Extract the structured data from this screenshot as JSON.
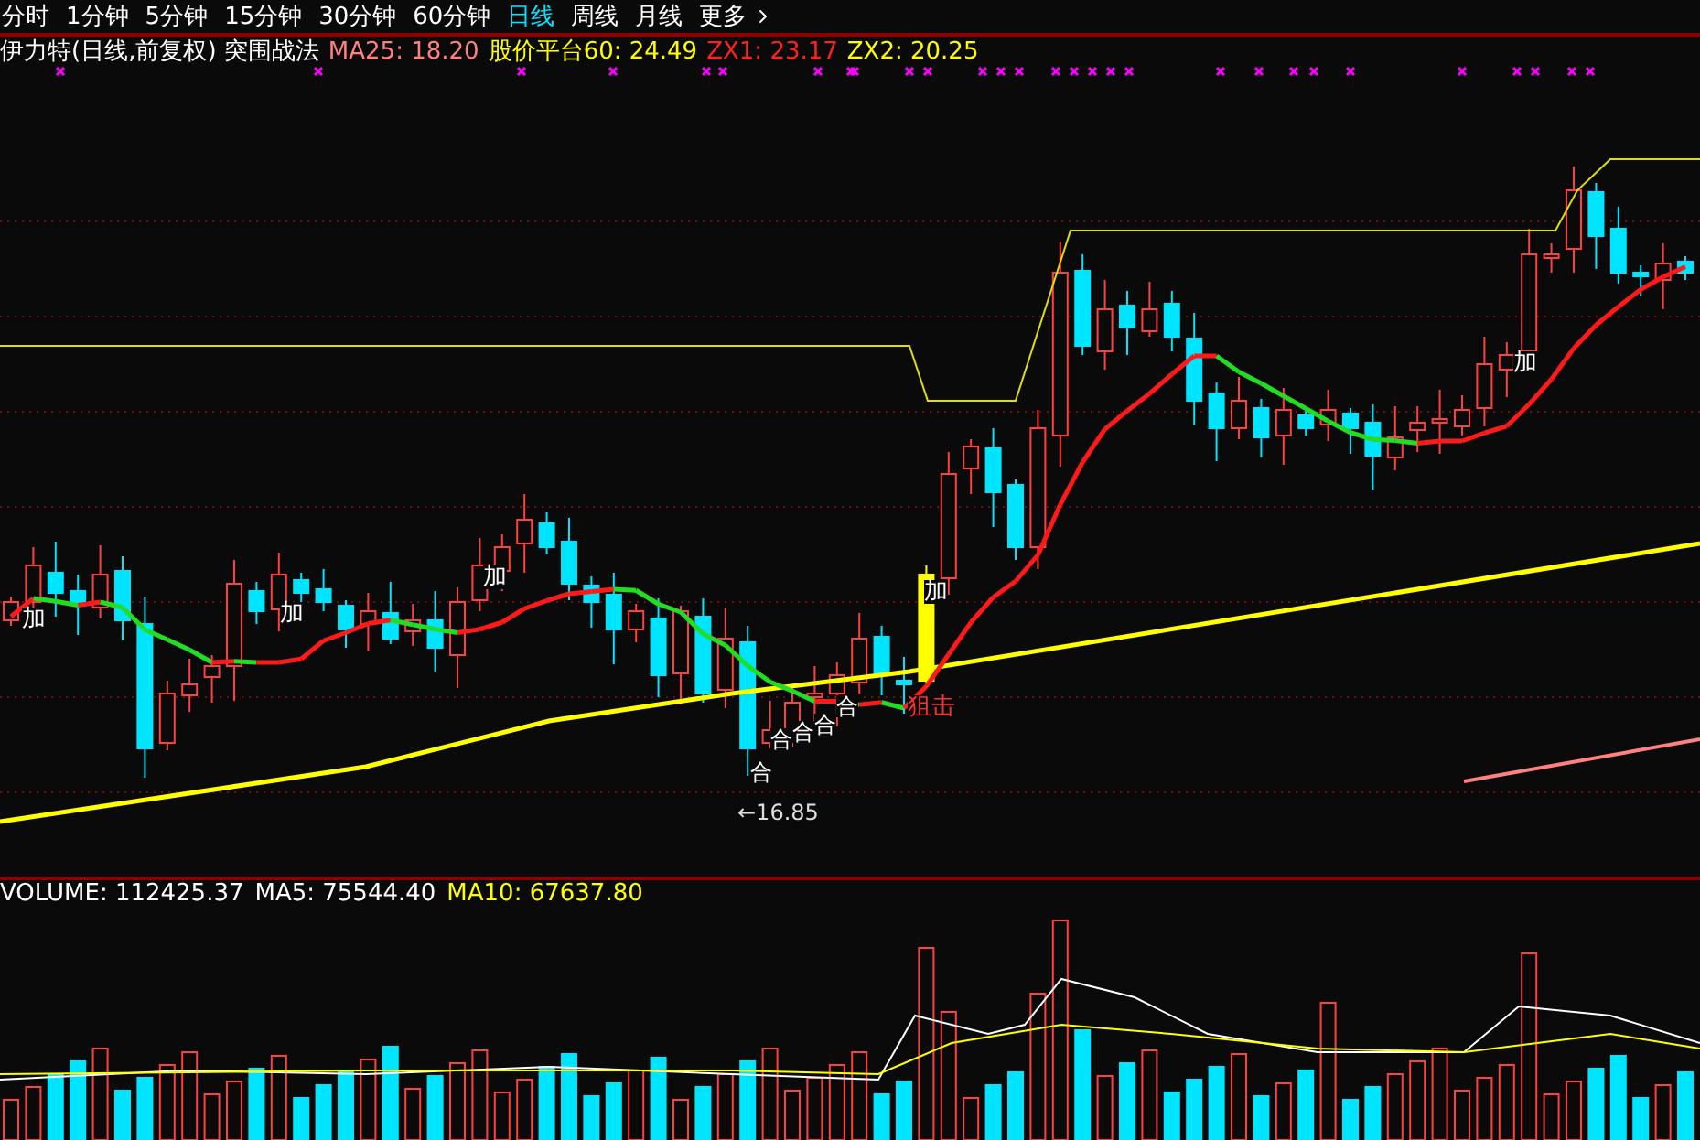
{
  "period_tabs": [
    {
      "label": "分时",
      "selected": false
    },
    {
      "label": "1分钟",
      "selected": false
    },
    {
      "label": "5分钟",
      "selected": false
    },
    {
      "label": "15分钟",
      "selected": false
    },
    {
      "label": "30分钟",
      "selected": false
    },
    {
      "label": "60分钟",
      "selected": false
    },
    {
      "label": "日线",
      "selected": true
    },
    {
      "label": "周线",
      "selected": false
    },
    {
      "label": "月线",
      "selected": false
    },
    {
      "label": "更多",
      "selected": false
    }
  ],
  "indicator_bar": {
    "title": "伊力特(日线,前复权) 突围战法",
    "readings": [
      {
        "text": "MA25: 18.20",
        "color": "#ff8080"
      },
      {
        "text": "股价平台60: 24.49",
        "color": "#ffff00"
      },
      {
        "text": "ZX1: 23.17",
        "color": "#ff2020"
      },
      {
        "text": "ZX2: 20.25",
        "color": "#ffff00"
      }
    ]
  },
  "main_chart": {
    "markers": [
      {
        "text": "加",
        "kind": "add"
      },
      {
        "text": "加",
        "kind": "add"
      },
      {
        "text": "加",
        "kind": "add"
      },
      {
        "text": "加",
        "kind": "add"
      },
      {
        "text": "加",
        "kind": "add"
      },
      {
        "text": "合",
        "kind": "merge"
      },
      {
        "text": "合",
        "kind": "merge"
      },
      {
        "text": "合",
        "kind": "merge"
      },
      {
        "text": "合",
        "kind": "merge"
      },
      {
        "text": "合",
        "kind": "merge"
      },
      {
        "text": "狙击",
        "kind": "snipe"
      },
      {
        "text": "←16.85",
        "kind": "low"
      }
    ]
  },
  "volume_header": {
    "readings": [
      {
        "text": "VOLUME: 112425.37",
        "color": "#ffffff"
      },
      {
        "text": "MA5: 75544.40",
        "color": "#ffffff"
      },
      {
        "text": "MA10: 67637.80",
        "color": "#ffff00"
      }
    ]
  }
}
